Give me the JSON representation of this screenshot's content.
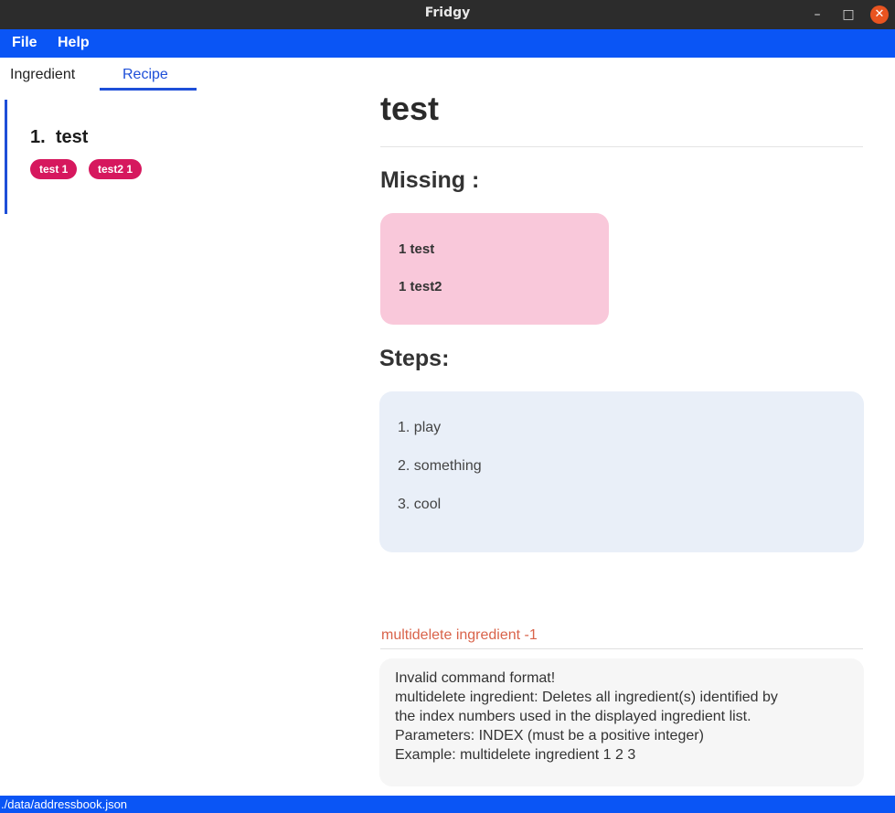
{
  "window": {
    "title": "Fridgy",
    "minimize_glyph": "–",
    "maximize_glyph": "□",
    "close_glyph": "✕"
  },
  "menu": {
    "items": [
      {
        "label": "File"
      },
      {
        "label": "Help"
      }
    ]
  },
  "tabs": [
    {
      "label": "Ingredient",
      "selected": false
    },
    {
      "label": "Recipe",
      "selected": true
    }
  ],
  "recipe_list": {
    "items": [
      {
        "index": "1.",
        "name": "test",
        "tags": [
          "test 1",
          "test2 1"
        ]
      }
    ]
  },
  "detail": {
    "title": "test",
    "missing_heading": "Missing :",
    "missing_items": [
      "1 test",
      "1 test2"
    ],
    "steps_heading": "Steps:",
    "steps": [
      "1. play",
      "2. something",
      "3. cool"
    ]
  },
  "command": {
    "value": "multidelete ingredient -1"
  },
  "result": {
    "text": "Invalid command format!\nmultidelete ingredient: Deletes all ingredient(s) identified by\nthe index numbers used in the displayed ingredient list.\nParameters: INDEX (must be a positive integer)\nExample: multidelete ingredient 1 2 3"
  },
  "status": {
    "path": "./data/addressbook.json"
  },
  "colors": {
    "accent_blue": "#0a55f5",
    "tag_pink": "#d6185e",
    "missing_bg": "#f9c8da",
    "steps_bg": "#e9eff8",
    "command_text": "#d9634a",
    "close_orange": "#e95420"
  }
}
